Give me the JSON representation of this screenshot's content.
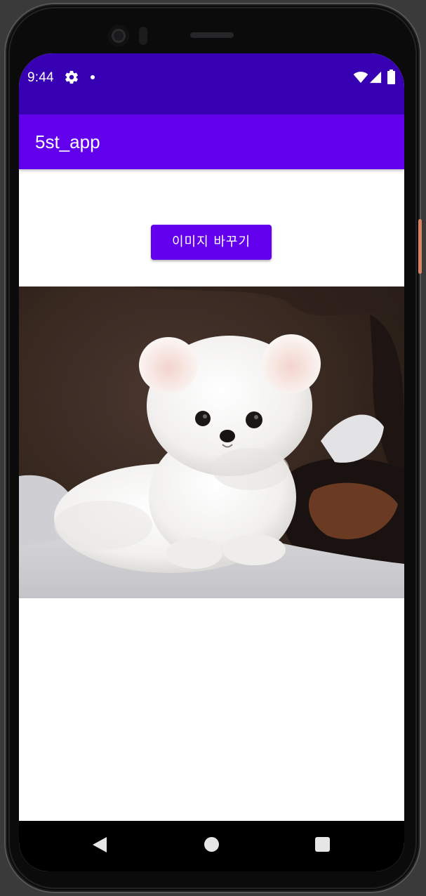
{
  "status_bar": {
    "time": "9:44",
    "icons": [
      "gear-icon",
      "notification-dot-icon",
      "wifi-icon",
      "cell-signal-icon",
      "battery-icon"
    ],
    "background_color": "#3700b3"
  },
  "app_bar": {
    "title": "5st_app",
    "background_color": "#6200ee"
  },
  "main": {
    "change_image_button_label": "이미지 바꾸기",
    "image_subject": "white puppy"
  },
  "nav_bar": {
    "icons": [
      "back-icon",
      "home-icon",
      "recents-icon"
    ]
  }
}
